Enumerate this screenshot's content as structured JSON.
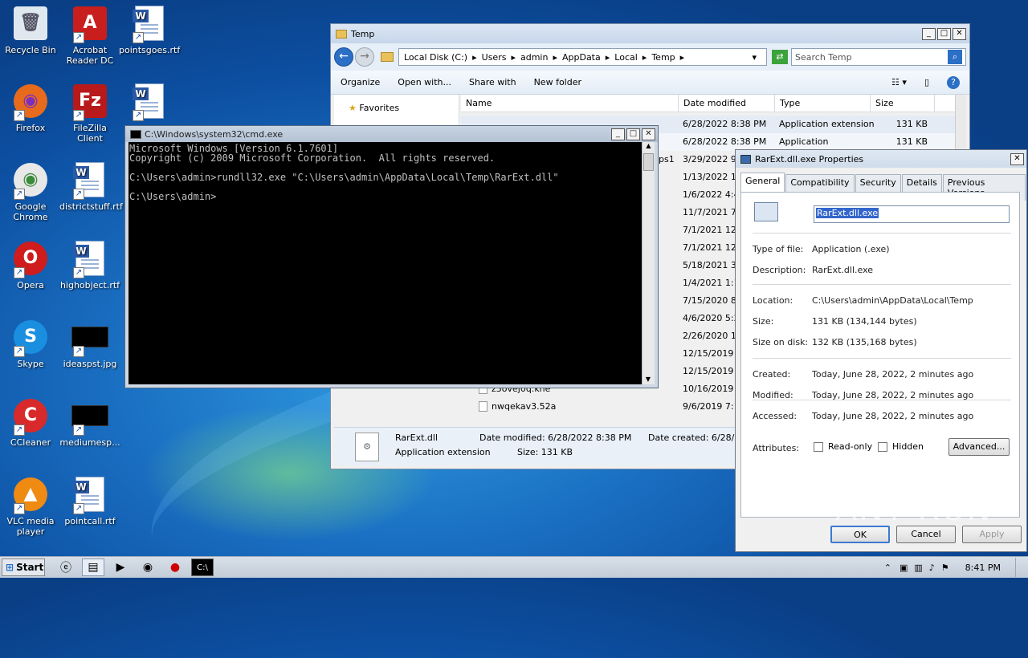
{
  "desktop_icons": [
    {
      "label": "Recycle Bin",
      "icon": "recycle-bin-icon"
    },
    {
      "label": "Acrobat Reader DC",
      "icon": "acrobat-icon"
    },
    {
      "label": "pointsgoes.rtf",
      "icon": "word-doc-icon"
    },
    {
      "label": "Firefox",
      "icon": "firefox-icon"
    },
    {
      "label": "FileZilla Client",
      "icon": "filezilla-icon"
    },
    {
      "label": "",
      "icon": "word-doc-icon"
    },
    {
      "label": "Google Chrome",
      "icon": "chrome-icon"
    },
    {
      "label": "districtstuff.rtf",
      "icon": "word-doc-icon"
    },
    {
      "label": "Opera",
      "icon": "opera-icon"
    },
    {
      "label": "highobject.rtf",
      "icon": "word-doc-icon"
    },
    {
      "label": "Skype",
      "icon": "skype-icon"
    },
    {
      "label": "ideaspst.jpg",
      "icon": "image-icon"
    },
    {
      "label": "CCleaner",
      "icon": "ccleaner-icon"
    },
    {
      "label": "mediumesp...",
      "icon": "image-icon"
    },
    {
      "label": "VLC media player",
      "icon": "vlc-icon"
    },
    {
      "label": "pointcall.rtf",
      "icon": "word-doc-icon"
    }
  ],
  "explorer": {
    "title": "Temp",
    "breadcrumb": [
      "Local Disk (C:)",
      "Users",
      "admin",
      "AppData",
      "Local",
      "Temp"
    ],
    "search_placeholder": "Search Temp",
    "commands": [
      "Organize",
      "Open with...",
      "Share with",
      "New folder"
    ],
    "nav_item": "Favorites",
    "columns": [
      "Name",
      "Date modified",
      "Type",
      "Size"
    ],
    "rows": [
      {
        "name": "",
        "date": "6/28/2022 8:38 PM",
        "type": "Application extension",
        "size": "131 KB"
      },
      {
        "name": "",
        "date": "6/28/2022 8:38 PM",
        "type": "Application",
        "size": "131 KB"
      },
      {
        "name": "",
        "date": "3/29/2022 9:",
        "type": "",
        "size": ""
      },
      {
        "name": "",
        "date": "1/13/2022 12",
        "type": "",
        "size": ""
      },
      {
        "name": "",
        "date": "1/6/2022 4:4",
        "type": "",
        "size": ""
      },
      {
        "name": "",
        "date": "11/7/2021 7:",
        "type": "",
        "size": ""
      },
      {
        "name": "",
        "date": "7/1/2021 12:",
        "type": "",
        "size": ""
      },
      {
        "name": "",
        "date": "7/1/2021 12:",
        "type": "",
        "size": ""
      },
      {
        "name": "",
        "date": "5/18/2021 3:",
        "type": "",
        "size": ""
      },
      {
        "name": "",
        "date": "1/4/2021 1:1",
        "type": "",
        "size": ""
      },
      {
        "name": "",
        "date": "7/15/2020 8:",
        "type": "",
        "size": ""
      },
      {
        "name": "",
        "date": "4/6/2020 5:2",
        "type": "",
        "size": ""
      },
      {
        "name": "",
        "date": "2/26/2020 11",
        "type": "",
        "size": ""
      },
      {
        "name": "",
        "date": "12/15/2019 1",
        "type": "",
        "size": ""
      },
      {
        "name": "",
        "date": "12/15/2019 1",
        "type": "",
        "size": ""
      },
      {
        "name": "z3ovej0q.khe",
        "date": "10/16/2019 1",
        "type": "",
        "size": ""
      },
      {
        "name": "nwqekav3.52a",
        "date": "9/6/2019 7:1",
        "type": "",
        "size": ""
      }
    ],
    "partial_name_fragment": "ps1",
    "details": {
      "name": "RarExt.dll",
      "type": "Application extension",
      "date_modified": "Date modified: 6/28/2022 8:38 PM",
      "size": "Size: 131 KB",
      "date_created": "Date created: 6/28/20"
    }
  },
  "cmd": {
    "title": "C:\\Windows\\system32\\cmd.exe",
    "lines": [
      "Microsoft Windows [Version 6.1.7601]",
      "Copyright (c) 2009 Microsoft Corporation.  All rights reserved.",
      "",
      "C:\\Users\\admin>rundll32.exe \"C:\\Users\\admin\\AppData\\Local\\Temp\\RarExt.dll\"",
      "",
      "C:\\Users\\admin>"
    ]
  },
  "props": {
    "title": "RarExt.dll.exe Properties",
    "tabs": [
      "General",
      "Compatibility",
      "Security",
      "Details",
      "Previous Versions"
    ],
    "filename": "RarExt.dll.exe",
    "fields": [
      {
        "label": "Type of file:",
        "value": "Application (.exe)"
      },
      {
        "label": "Description:",
        "value": "RarExt.dll.exe"
      },
      {
        "label": "Location:",
        "value": "C:\\Users\\admin\\AppData\\Local\\Temp"
      },
      {
        "label": "Size:",
        "value": "131 KB (134,144 bytes)"
      },
      {
        "label": "Size on disk:",
        "value": "132 KB (135,168 bytes)"
      },
      {
        "label": "Created:",
        "value": "Today, June 28, 2022, 2 minutes ago"
      },
      {
        "label": "Modified:",
        "value": "Today, June 28, 2022, 2 minutes ago"
      },
      {
        "label": "Accessed:",
        "value": "Today, June 28, 2022, 2 minutes ago"
      }
    ],
    "attributes_label": "Attributes:",
    "readonly_label": "Read-only",
    "hidden_label": "Hidden",
    "advanced_label": "Advanced...",
    "ok_label": "OK",
    "cancel_label": "Cancel",
    "apply_label": "Apply"
  },
  "taskbar": {
    "start_label": "Start",
    "clock": "8:41 PM"
  },
  "watermark": "ANY RUN"
}
